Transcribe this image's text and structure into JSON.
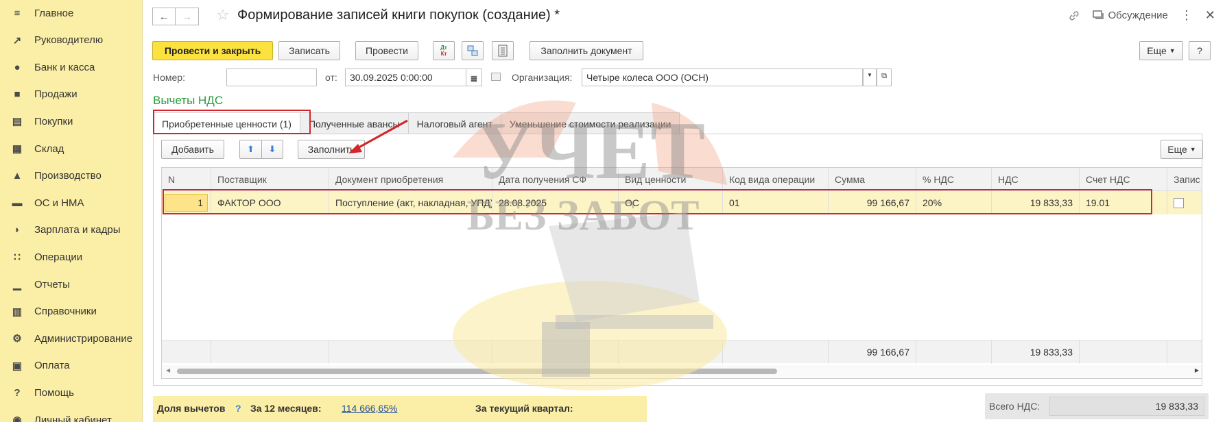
{
  "sidebar": {
    "items": [
      {
        "label": "Главное",
        "icon": "menu-icon"
      },
      {
        "label": "Руководителю",
        "icon": "trend-icon"
      },
      {
        "label": "Банк и касса",
        "icon": "coin-icon"
      },
      {
        "label": "Продажи",
        "icon": "bag-icon"
      },
      {
        "label": "Покупки",
        "icon": "cart-icon"
      },
      {
        "label": "Склад",
        "icon": "warehouse-icon"
      },
      {
        "label": "Производство",
        "icon": "factory-icon"
      },
      {
        "label": "ОС и НМА",
        "icon": "truck-icon"
      },
      {
        "label": "Зарплата и кадры",
        "icon": "person-icon"
      },
      {
        "label": "Операции",
        "icon": "dt-kt-icon"
      },
      {
        "label": "Отчеты",
        "icon": "bar-chart-icon"
      },
      {
        "label": "Справочники",
        "icon": "book-icon"
      },
      {
        "label": "Администрирование",
        "icon": "gear-icon"
      },
      {
        "label": "Оплата",
        "icon": "wallet-icon"
      },
      {
        "label": "Помощь",
        "icon": "question-icon"
      },
      {
        "label": "Личный кабинет",
        "icon": "account-icon"
      }
    ]
  },
  "header": {
    "title": "Формирование записей книги покупок (создание) *",
    "discussion": "Обсуждение"
  },
  "toolbar": {
    "post_close": "Провести и закрыть",
    "save": "Записать",
    "post": "Провести",
    "fill_document": "Заполнить документ",
    "more": "Еще",
    "help": "?",
    "dtkt_icon_text_top": "Дт",
    "dtkt_icon_text_bottom": "Кт"
  },
  "form": {
    "number_label": "Номер:",
    "number_value": "",
    "date_label": "от:",
    "date_value": "30.09.2025  0:00:00",
    "org_label": "Организация:",
    "org_value": "Четыре колеса ООО (ОСН)"
  },
  "section_title": "Вычеты НДС",
  "tabs": [
    {
      "label": "Приобретенные ценности (1)",
      "active": true
    },
    {
      "label": "Полученные авансы",
      "active": false
    },
    {
      "label": "Налоговый агент",
      "active": false
    },
    {
      "label": "Уменьшение стоимости реализации",
      "active": false
    }
  ],
  "panel_toolbar": {
    "add": "Добавить",
    "fill": "Заполнить",
    "more": "Еще"
  },
  "table": {
    "columns": [
      "N",
      "Поставщик",
      "Документ приобретения",
      "Дата получения СФ",
      "Вид ценности",
      "Код вида операции",
      "Сумма",
      "% НДС",
      "НДС",
      "Счет НДС",
      "Запис"
    ],
    "rows": [
      {
        "n": "1",
        "supplier": "ФАКТОР ООО",
        "document": "Поступление (акт, накладная, УПД)",
        "date": "28.08.2025",
        "kind": "ОС",
        "op_code": "01",
        "sum": "99 166,67",
        "vat_rate": "20%",
        "vat": "19 833,33",
        "vat_account": "19.01"
      }
    ],
    "footer": {
      "sum": "99 166,67",
      "vat": "19 833,33"
    }
  },
  "bottom": {
    "share_label": "Доля вычетов",
    "help": "?",
    "months_label": "За 12 месяцев:",
    "months_value": "114 666,65%",
    "quarter_label": "За текущий квартал:",
    "total_vat_label": "Всего НДС:",
    "total_vat_value": "19 833,33"
  },
  "watermark": {
    "line1": "УЧЕТ",
    "line2": "БЕЗ ЗАБОТ"
  },
  "colors": {
    "sidebar_bg": "#fbeea6",
    "primary_button": "#fce23e",
    "section_title": "#2a9a3c",
    "selected_row": "#fdf4c6",
    "highlight": "#d2262c"
  }
}
